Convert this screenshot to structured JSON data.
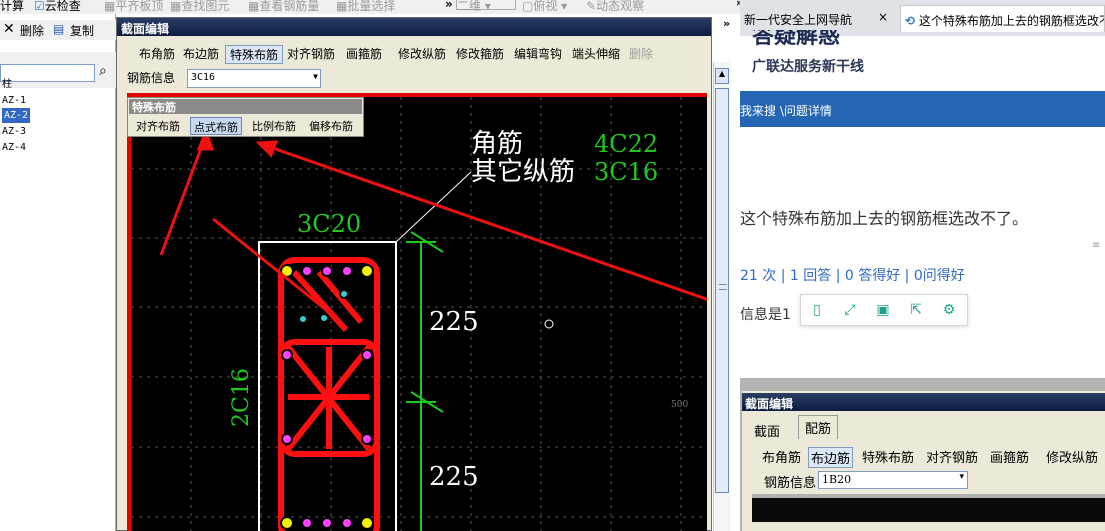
{
  "toolbar": {
    "items": [
      "计算",
      "云检查",
      "平齐板顶",
      "查找图元",
      "查看钢筋量",
      "批量选择",
      "二维",
      "俯视",
      "动态观察"
    ],
    "chevron": "»"
  },
  "left_pane": {
    "delete_label": "删除",
    "copy_label": "复制",
    "tree": [
      "柱",
      "AZ-1",
      "AZ-2",
      "AZ-3",
      "AZ-4"
    ],
    "selected": "AZ-2"
  },
  "dialog": {
    "title": "截面编辑",
    "buttons": [
      "布角筋",
      "布边筋",
      "特殊布筋",
      "对齐钢筋",
      "画箍筋",
      "修改纵筋",
      "修改箍筋",
      "编辑弯钩",
      "端头伸缩",
      "删除"
    ],
    "active_button": "特殊布筋",
    "disabled_button": "删除",
    "info_label": "钢筋信息",
    "info_value": "3C16",
    "popup": {
      "title": "特殊布筋",
      "buttons": [
        "对齐布筋",
        "点式布筋",
        "比例布筋",
        "偏移布筋"
      ],
      "active": "点式布筋"
    },
    "canvas": {
      "corner_label": "角筋",
      "corner_value": "4C22",
      "other_label": "其它纵筋",
      "other_value": "3C16",
      "top_rebar": "3C20",
      "side_rebar": "2C16",
      "dim1": "225",
      "dim2": "225",
      "grid_label": "500"
    },
    "colors": {
      "red": "#ff1010",
      "green": "#1ec81e",
      "magenta": "#ff40ff",
      "yellow": "#f0f000",
      "cyan": "#30d0d0",
      "canvas": "#000000"
    }
  },
  "browser": {
    "tab1": "新一代安全上网导航",
    "tab2": "这个特殊布筋加上去的钢筋框选改不了",
    "tab1_close": "×",
    "banner_title": "答疑解惑",
    "banner_sub": "广联达服务新干线",
    "nav_text": "我来搜 \\问题详情",
    "question": "这个特殊布筋加上去的钢筋框选改不了。",
    "stats": "21 次 | 1 回答 | 0 答得好 | 0问得好",
    "info_text": "信息是1",
    "share_icons": [
      "phone-icon",
      "expand-icon",
      "save-icon",
      "share-icon",
      "settings-icon"
    ],
    "screenshot": {
      "title": "截面编辑",
      "tabs": [
        "截面",
        "配筋"
      ],
      "buttons": [
        "布角筋",
        "布边筋",
        "特殊布筋",
        "对齐钢筋",
        "画箍筋",
        "修改纵筋"
      ],
      "active_button": "布边筋",
      "info_label": "钢筋信息",
      "info_value": "1B20"
    }
  }
}
